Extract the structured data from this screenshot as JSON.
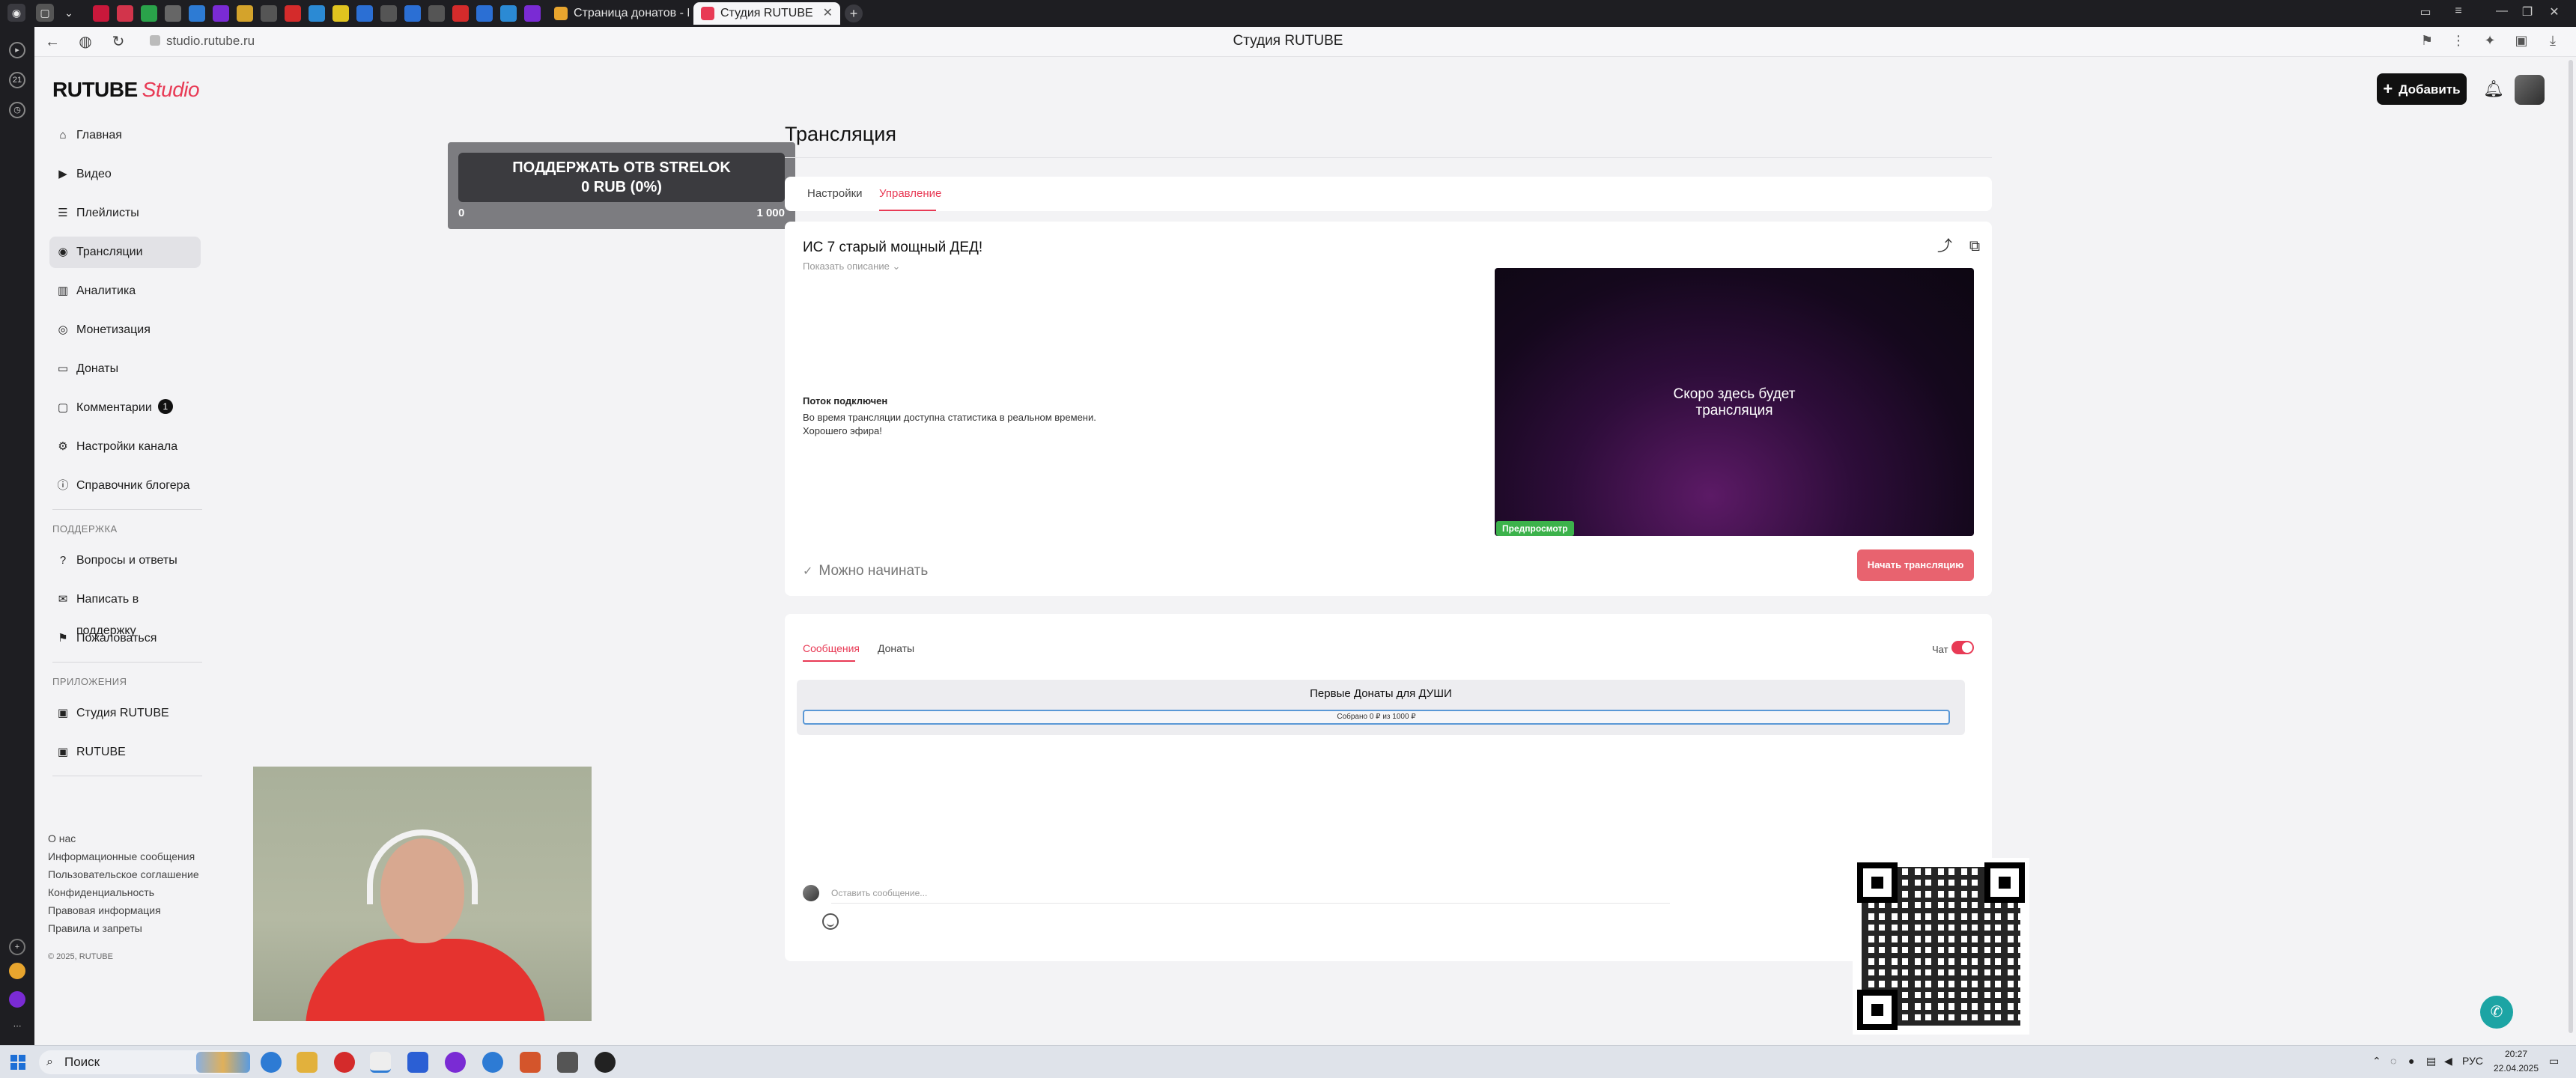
{
  "browser": {
    "tabs": [
      {
        "label": "Страница донатов - Пан",
        "active": false
      },
      {
        "label": "Студия RUTUBE",
        "active": true
      }
    ],
    "url": "studio.rutube.ru",
    "page_title": "Студия RUTUBE"
  },
  "header": {
    "logo_main": "RUTUBE",
    "logo_studio": "Studio",
    "add_label": "Добавить"
  },
  "sidebar": {
    "items": [
      {
        "label": "Главная",
        "icon": "home-icon"
      },
      {
        "label": "Видео",
        "icon": "video-icon"
      },
      {
        "label": "Плейлисты",
        "icon": "playlist-icon"
      },
      {
        "label": "Трансляции",
        "icon": "broadcast-icon",
        "active": true
      },
      {
        "label": "Аналитика",
        "icon": "chart-icon"
      },
      {
        "label": "Монетизация",
        "icon": "coins-icon"
      },
      {
        "label": "Донаты",
        "icon": "wallet-icon"
      },
      {
        "label": "Комментарии",
        "icon": "comment-icon",
        "badge": "1"
      },
      {
        "label": "Настройки канала",
        "icon": "gear-icon"
      },
      {
        "label": "Справочник блогера",
        "icon": "info-icon"
      }
    ],
    "support_caption": "ПОДДЕРЖКА",
    "support_items": [
      {
        "label": "Вопросы и ответы",
        "icon": "question-icon"
      },
      {
        "label": "Написать в поддержку",
        "icon": "chat-icon"
      },
      {
        "label": "Пожаловаться",
        "icon": "flag-icon"
      }
    ],
    "apps_caption": "ПРИЛОЖЕНИЯ",
    "apps_items": [
      {
        "label": "Студия RUTUBE",
        "icon": "studio-icon"
      },
      {
        "label": "RUTUBE",
        "icon": "rutube-icon"
      }
    ],
    "footer_links": [
      "О нас",
      "Информационные сообщения",
      "Пользовательское соглашение",
      "Конфиденциальность",
      "Правовая информация",
      "Правила и запреты"
    ],
    "copyright": "© 2025, RUTUBE"
  },
  "donation_widget": {
    "line1": "ПОДДЕРЖАТЬ ОТВ STRELOK",
    "line2": "0 RUB (0%)",
    "min": "0",
    "max": "1 000",
    "progress": 0
  },
  "main": {
    "title": "Трансляция",
    "tabs": [
      {
        "label": "Настройки"
      },
      {
        "label": "Управление",
        "active": true
      }
    ],
    "stream": {
      "title": "ИС 7 старый мощный ДЕД!",
      "show_description": "Показать описание",
      "status_heading": "Поток подключен",
      "status_line1": "Во время трансляции доступна статистика в реальном времени.",
      "status_line2": "Хорошего эфира!",
      "preview_text": "Скоро здесь будет трансляция",
      "preview_badge": "Предпросмотр",
      "ready_text": "Можно начинать",
      "start_label": "Начать трансляцию"
    },
    "chat": {
      "tabs": [
        {
          "label": "Сообщения",
          "active": true
        },
        {
          "label": "Донаты"
        }
      ],
      "chat_toggle_label": "Чат",
      "chat_enabled": true,
      "goal_title": "Первые Донаты для ДУШИ",
      "goal_progress_text": "Собрано 0 ₽ из 1000 ₽",
      "goal_progress": 0,
      "message_placeholder": "Оставить сообщение..."
    }
  },
  "taskbar": {
    "search_label": "Поиск",
    "lang": "РУС",
    "time": "20:27",
    "date": "22.04.2025"
  },
  "colors": {
    "accent": "#e83a55",
    "start_button": "#e8636f",
    "preview_badge": "#3cb24b"
  }
}
